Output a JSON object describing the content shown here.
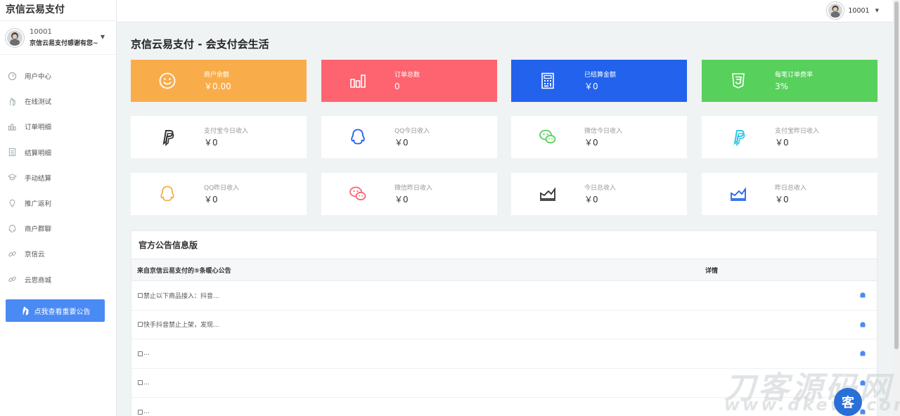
{
  "app": {
    "brand": "京信云易支付"
  },
  "user": {
    "id": "10001",
    "subtitle": "京信云易支付感谢有您~"
  },
  "sidebar": {
    "items": [
      {
        "label": "用户中心",
        "icon": "dashboard-icon"
      },
      {
        "label": "在线测试",
        "icon": "hand-icon"
      },
      {
        "label": "订单明细",
        "icon": "bar-chart-icon"
      },
      {
        "label": "结算明细",
        "icon": "document-icon"
      },
      {
        "label": "手动结算",
        "icon": "graduation-cap-icon"
      },
      {
        "label": "推广返利",
        "icon": "lightbulb-icon"
      },
      {
        "label": "商户群聊",
        "icon": "qq-icon"
      },
      {
        "label": "京信云",
        "icon": "link-icon"
      },
      {
        "label": "云思商城",
        "icon": "link-icon"
      }
    ],
    "notice_button": "点我查看重要公告"
  },
  "topbar": {
    "user_id": "10001"
  },
  "page": {
    "title": "京信云易支付 - 会支付会生活"
  },
  "stats": [
    {
      "label": "商户余额",
      "value": "￥0.00",
      "bg": "#f9ad4a",
      "icon": "smile-icon"
    },
    {
      "label": "订单总数",
      "value": "0",
      "bg": "#fd6470",
      "icon": "bar-chart-icon"
    },
    {
      "label": "已结算金额",
      "value": "￥0",
      "bg": "#2262ec",
      "icon": "calculator-icon"
    },
    {
      "label": "每笔订单费率",
      "value": "3%",
      "bg": "#57d05c",
      "icon": "css3-icon"
    }
  ],
  "income_today": [
    {
      "label": "支付宝今日收入",
      "value": "￥0",
      "icon": "paypal-icon",
      "color": "#333333"
    },
    {
      "label": "QQ今日收入",
      "value": "￥0",
      "icon": "qq-icon",
      "color": "#2262ec"
    },
    {
      "label": "微信今日收入",
      "value": "￥0",
      "icon": "wechat-icon",
      "color": "#57d05c"
    },
    {
      "label": "支付宝昨日收入",
      "value": "￥0",
      "icon": "paypal-icon",
      "color": "#2fc8e6"
    }
  ],
  "income_yesterday": [
    {
      "label": "QQ昨日收入",
      "value": "￥0",
      "icon": "qq-icon",
      "color": "#f9ad4a"
    },
    {
      "label": "微信昨日收入",
      "value": "￥0",
      "icon": "wechat-icon",
      "color": "#fd6470"
    },
    {
      "label": "今日总收入",
      "value": "￥0",
      "icon": "area-chart-icon",
      "color": "#333333"
    },
    {
      "label": "昨日总收入",
      "value": "￥0",
      "icon": "area-chart-icon",
      "color": "#2262ec"
    }
  ],
  "announcements": {
    "title": "官方公告信息版",
    "col_title": "来自京信云易支付的⑤条暖心公告",
    "col_detail": "详情",
    "rows": [
      {
        "text": "禁止以下商品接入：抖音..."
      },
      {
        "text": "快手抖音禁止上架，发现..."
      },
      {
        "text": "..."
      },
      {
        "text": "..."
      },
      {
        "text": "..."
      }
    ]
  },
  "watermark": {
    "line1": "刀客源码网",
    "line2": "www.dkewl.com"
  }
}
